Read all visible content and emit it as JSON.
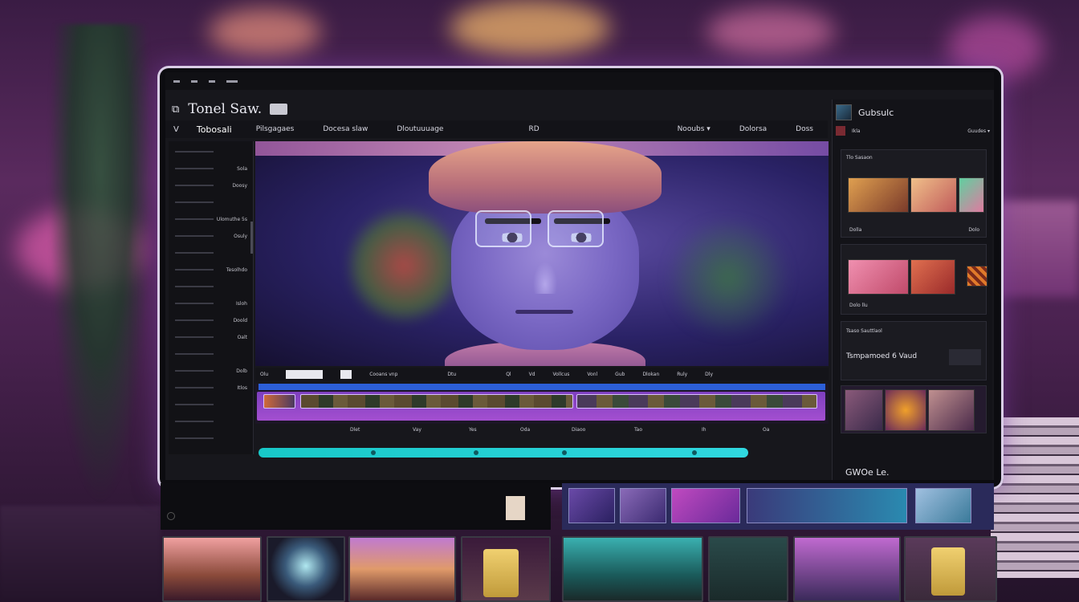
{
  "window": {
    "title": "Tonel Saw."
  },
  "menubar": {
    "selector": "Tobosali",
    "items": [
      "Pilsgagaes",
      "Docesa slaw",
      "Dloutuuuage",
      "RD"
    ],
    "right_items": [
      "Nooubs ▾",
      "Dolorsa",
      "Doss"
    ]
  },
  "left_panel": {
    "rows": [
      "",
      "Sola",
      "Doosy",
      "",
      "Ulomuthe 5s",
      "Osuly",
      "",
      "Tesolhdo",
      "",
      "Isloh",
      "Doold",
      "Oalt",
      "",
      "Dolb",
      "Itlos",
      "",
      "",
      ""
    ]
  },
  "transport": {
    "items": [
      "Olu",
      "Cooans vnp",
      "Dtu",
      "Ql",
      "Vd",
      "Vollcus",
      "Vonl",
      "Gub",
      "Dlokan",
      "Ruly",
      "Dly"
    ]
  },
  "timeline_labels": [
    "Dlet",
    "Vay",
    "Yes",
    "Oda",
    "Diaoo",
    "Tao",
    "Ih",
    "Oa"
  ],
  "right_panel": {
    "title": "Gubsulc",
    "sub_left": "Ikla",
    "sub_right": "Guudes ▾",
    "card1_label": "Tlo Sasaon",
    "card1_footer_left": "Dolla",
    "card1_footer_right": "Dolo",
    "card2_footer": "Dolo llu",
    "card3_label": "Tsaso Sauttlaol",
    "card3_title": "Tsmpamoed 6 Vaud",
    "footer": "GWOe Le."
  },
  "colors": {
    "accent_cyan": "#20d0d8",
    "accent_purple": "#9a48cc",
    "timeline_blue": "#2c5fd8"
  }
}
